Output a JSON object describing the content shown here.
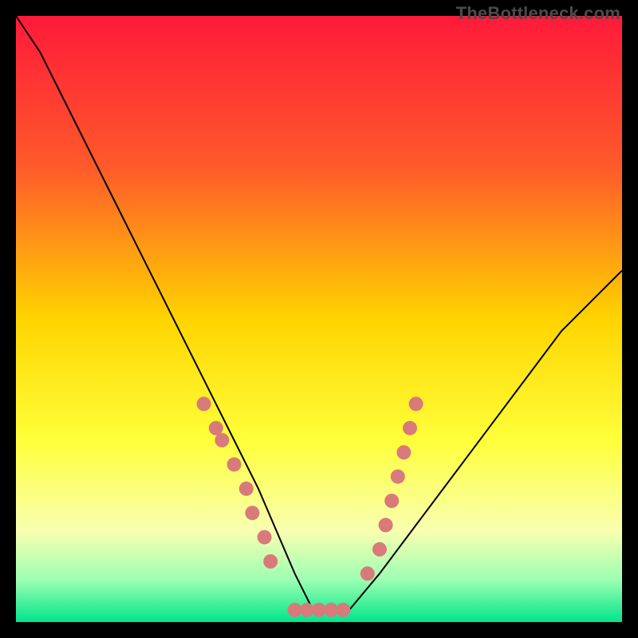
{
  "watermark": "TheBottleneck.com",
  "chart_data": {
    "type": "line",
    "title": "",
    "xlabel": "",
    "ylabel": "",
    "xlim": [
      0,
      100
    ],
    "ylim": [
      0,
      100
    ],
    "background_gradient": {
      "stops": [
        {
          "pos": 0.0,
          "color": "#ff1a3a"
        },
        {
          "pos": 0.25,
          "color": "#ff5a2a"
        },
        {
          "pos": 0.5,
          "color": "#ffd400"
        },
        {
          "pos": 0.7,
          "color": "#ffff3a"
        },
        {
          "pos": 0.85,
          "color": "#f8ffb0"
        },
        {
          "pos": 0.93,
          "color": "#9dffb3"
        },
        {
          "pos": 1.0,
          "color": "#00e58a"
        }
      ]
    },
    "series": [
      {
        "name": "bottleneck-curve",
        "color": "#000000",
        "width": 2,
        "x": [
          0,
          4,
          8,
          12,
          16,
          20,
          24,
          28,
          32,
          36,
          40,
          43,
          46,
          49,
          52,
          55,
          60,
          66,
          72,
          78,
          84,
          90,
          96,
          100
        ],
        "y": [
          100,
          94,
          86,
          78,
          70,
          62,
          54,
          46,
          38,
          30,
          22,
          15,
          8,
          2,
          2,
          2,
          8,
          16,
          24,
          32,
          40,
          48,
          54,
          58
        ]
      }
    ],
    "markers": [
      {
        "name": "left-cluster",
        "color": "#d97a7a",
        "points": [
          {
            "x": 31,
            "y": 36
          },
          {
            "x": 33,
            "y": 32
          },
          {
            "x": 34,
            "y": 30
          },
          {
            "x": 36,
            "y": 26
          },
          {
            "x": 38,
            "y": 22
          },
          {
            "x": 39,
            "y": 18
          },
          {
            "x": 41,
            "y": 14
          },
          {
            "x": 42,
            "y": 10
          }
        ]
      },
      {
        "name": "bottom-cluster",
        "color": "#d97a7a",
        "points": [
          {
            "x": 46,
            "y": 2
          },
          {
            "x": 48,
            "y": 2
          },
          {
            "x": 50,
            "y": 2
          },
          {
            "x": 52,
            "y": 2
          },
          {
            "x": 54,
            "y": 2
          }
        ]
      },
      {
        "name": "right-cluster",
        "color": "#d97a7a",
        "points": [
          {
            "x": 58,
            "y": 8
          },
          {
            "x": 60,
            "y": 12
          },
          {
            "x": 61,
            "y": 16
          },
          {
            "x": 62,
            "y": 20
          },
          {
            "x": 63,
            "y": 24
          },
          {
            "x": 64,
            "y": 28
          },
          {
            "x": 65,
            "y": 32
          },
          {
            "x": 66,
            "y": 36
          }
        ]
      }
    ]
  }
}
